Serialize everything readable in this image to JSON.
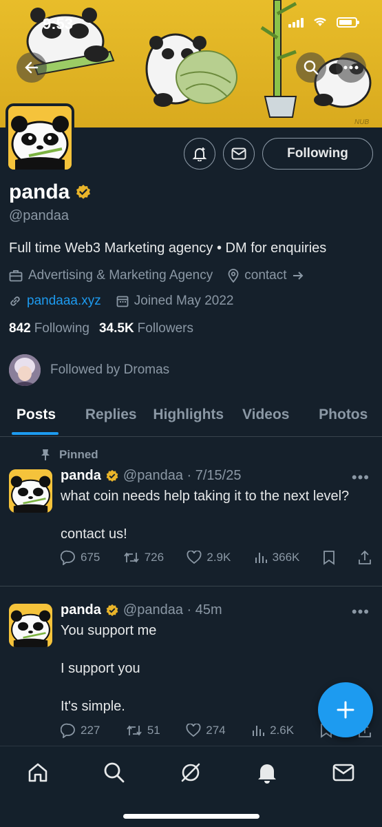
{
  "status_bar": {
    "time": "9:53"
  },
  "banner": {
    "signature": "NUB"
  },
  "profile": {
    "name": "panda",
    "handle": "@pandaa",
    "bio": "Full time Web3 Marketing agency • DM for enquiries",
    "category": "Advertising & Marketing Agency",
    "contact_label": "contact",
    "website": "pandaaa.xyz",
    "joined": "Joined May 2022",
    "following_count": "842",
    "following_label": "Following",
    "followers_count": "34.5K",
    "followers_label": "Followers",
    "followed_by": "Followed by Dromas",
    "follow_button_label": "Following"
  },
  "tabs": [
    {
      "label": "Posts",
      "active": true
    },
    {
      "label": "Replies",
      "active": false
    },
    {
      "label": "Highlights",
      "active": false
    },
    {
      "label": "Videos",
      "active": false
    },
    {
      "label": "Photos",
      "active": false
    }
  ],
  "posts": [
    {
      "pinned_label": "Pinned",
      "author": "panda",
      "handle_time": "@pandaa · 7/15/25",
      "text_line1": "what coin needs help taking it to the next level?",
      "text_line2": "contact us!",
      "replies": "675",
      "reposts": "726",
      "likes": "2.9K",
      "views": "366K"
    },
    {
      "author": "panda",
      "handle_time": "@pandaa · 45m",
      "text_line1": "You support me",
      "text_line2": "I support you",
      "text_line3": "It's simple.",
      "replies": "227",
      "reposts": "51",
      "likes": "274",
      "views": "2.6K"
    }
  ],
  "colors": {
    "accent": "#1d9bf0",
    "background": "#15202b",
    "banner": "#e3b425",
    "verified": "#e9b42a"
  }
}
